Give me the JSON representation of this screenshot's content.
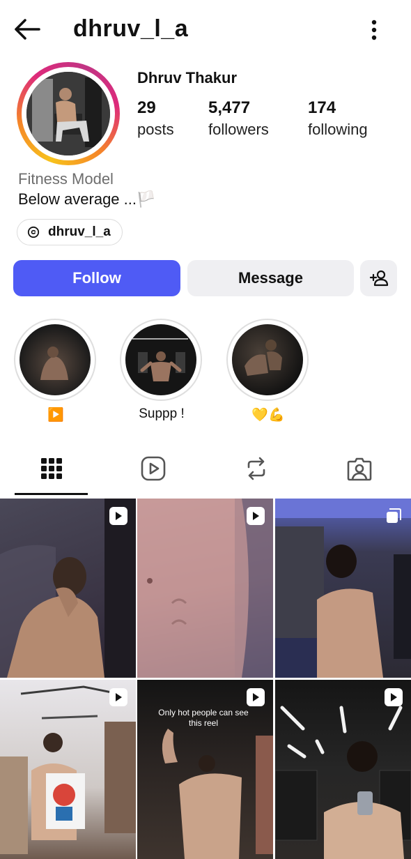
{
  "header": {
    "username": "dhruv_l_a",
    "back_icon": "arrow-left-icon",
    "menu_icon": "more-vertical-icon"
  },
  "profile": {
    "full_name": "Dhruv Thakur",
    "stats": [
      {
        "value": "29",
        "label": "posts"
      },
      {
        "value": "5,477",
        "label": "followers"
      },
      {
        "value": "174",
        "label": "following"
      }
    ],
    "category": "Fitness Model",
    "bio": "Below average ...🏳️",
    "threads_handle": "dhruv_l_a"
  },
  "actions": {
    "follow": "Follow",
    "message": "Message",
    "add_person_icon": "add-person-icon",
    "accent_color": "#4f5bf5"
  },
  "highlights": [
    {
      "label": "▶️"
    },
    {
      "label": "Suppp !"
    },
    {
      "label": "💛💪"
    }
  ],
  "tabs": [
    {
      "icon": "grid-icon",
      "active": true
    },
    {
      "icon": "reels-icon",
      "active": false
    },
    {
      "icon": "reposts-icon",
      "active": false
    },
    {
      "icon": "tagged-icon",
      "active": false
    }
  ],
  "grid": [
    {
      "badge": "reel"
    },
    {
      "badge": "reel"
    },
    {
      "badge": "carousel"
    },
    {
      "badge": "reel"
    },
    {
      "badge": "reel",
      "caption": "Only hot people can see this reel"
    },
    {
      "badge": "reel"
    }
  ]
}
